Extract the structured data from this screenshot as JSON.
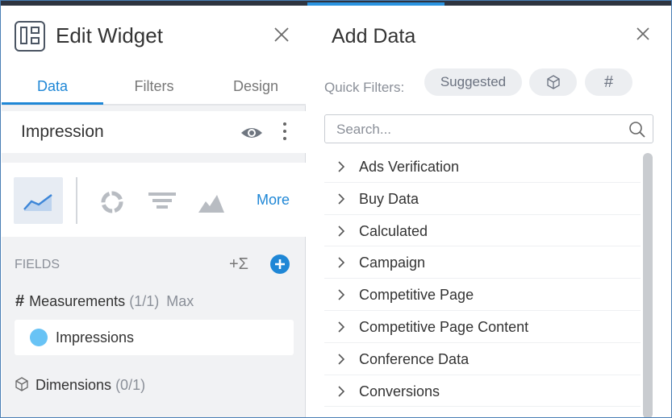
{
  "left_panel": {
    "title": "Edit Widget",
    "tabs": [
      {
        "label": "Data",
        "active": true
      },
      {
        "label": "Filters",
        "active": false
      },
      {
        "label": "Design",
        "active": false
      }
    ],
    "widget_name": "Impression",
    "chart_types": {
      "icons": [
        "line-chart-icon",
        "donut-chart-icon",
        "funnel-chart-icon",
        "area-chart-icon"
      ],
      "more_label": "More"
    },
    "fields": {
      "label": "FIELDS",
      "add_formula": "+Σ"
    },
    "measurements": {
      "hash": "#",
      "label": "Measurements",
      "count": "(1/1)",
      "max": "Max",
      "items": [
        {
          "label": "Impressions",
          "color": "#68c3f5"
        }
      ]
    },
    "dimensions": {
      "label": "Dimensions",
      "count": "(0/1)"
    }
  },
  "right_panel": {
    "title": "Add Data",
    "quick_filters_label": "Quick Filters:",
    "chips": {
      "suggested": "Suggested",
      "hash": "#"
    },
    "search": {
      "placeholder": "Search..."
    },
    "categories": [
      "Ads Verification",
      "Buy Data",
      "Calculated",
      "Campaign",
      "Competitive Page",
      "Competitive Page Content",
      "Conference Data",
      "Conversions"
    ]
  },
  "colors": {
    "accent": "#1f87d6",
    "dot": "#68c3f5"
  }
}
